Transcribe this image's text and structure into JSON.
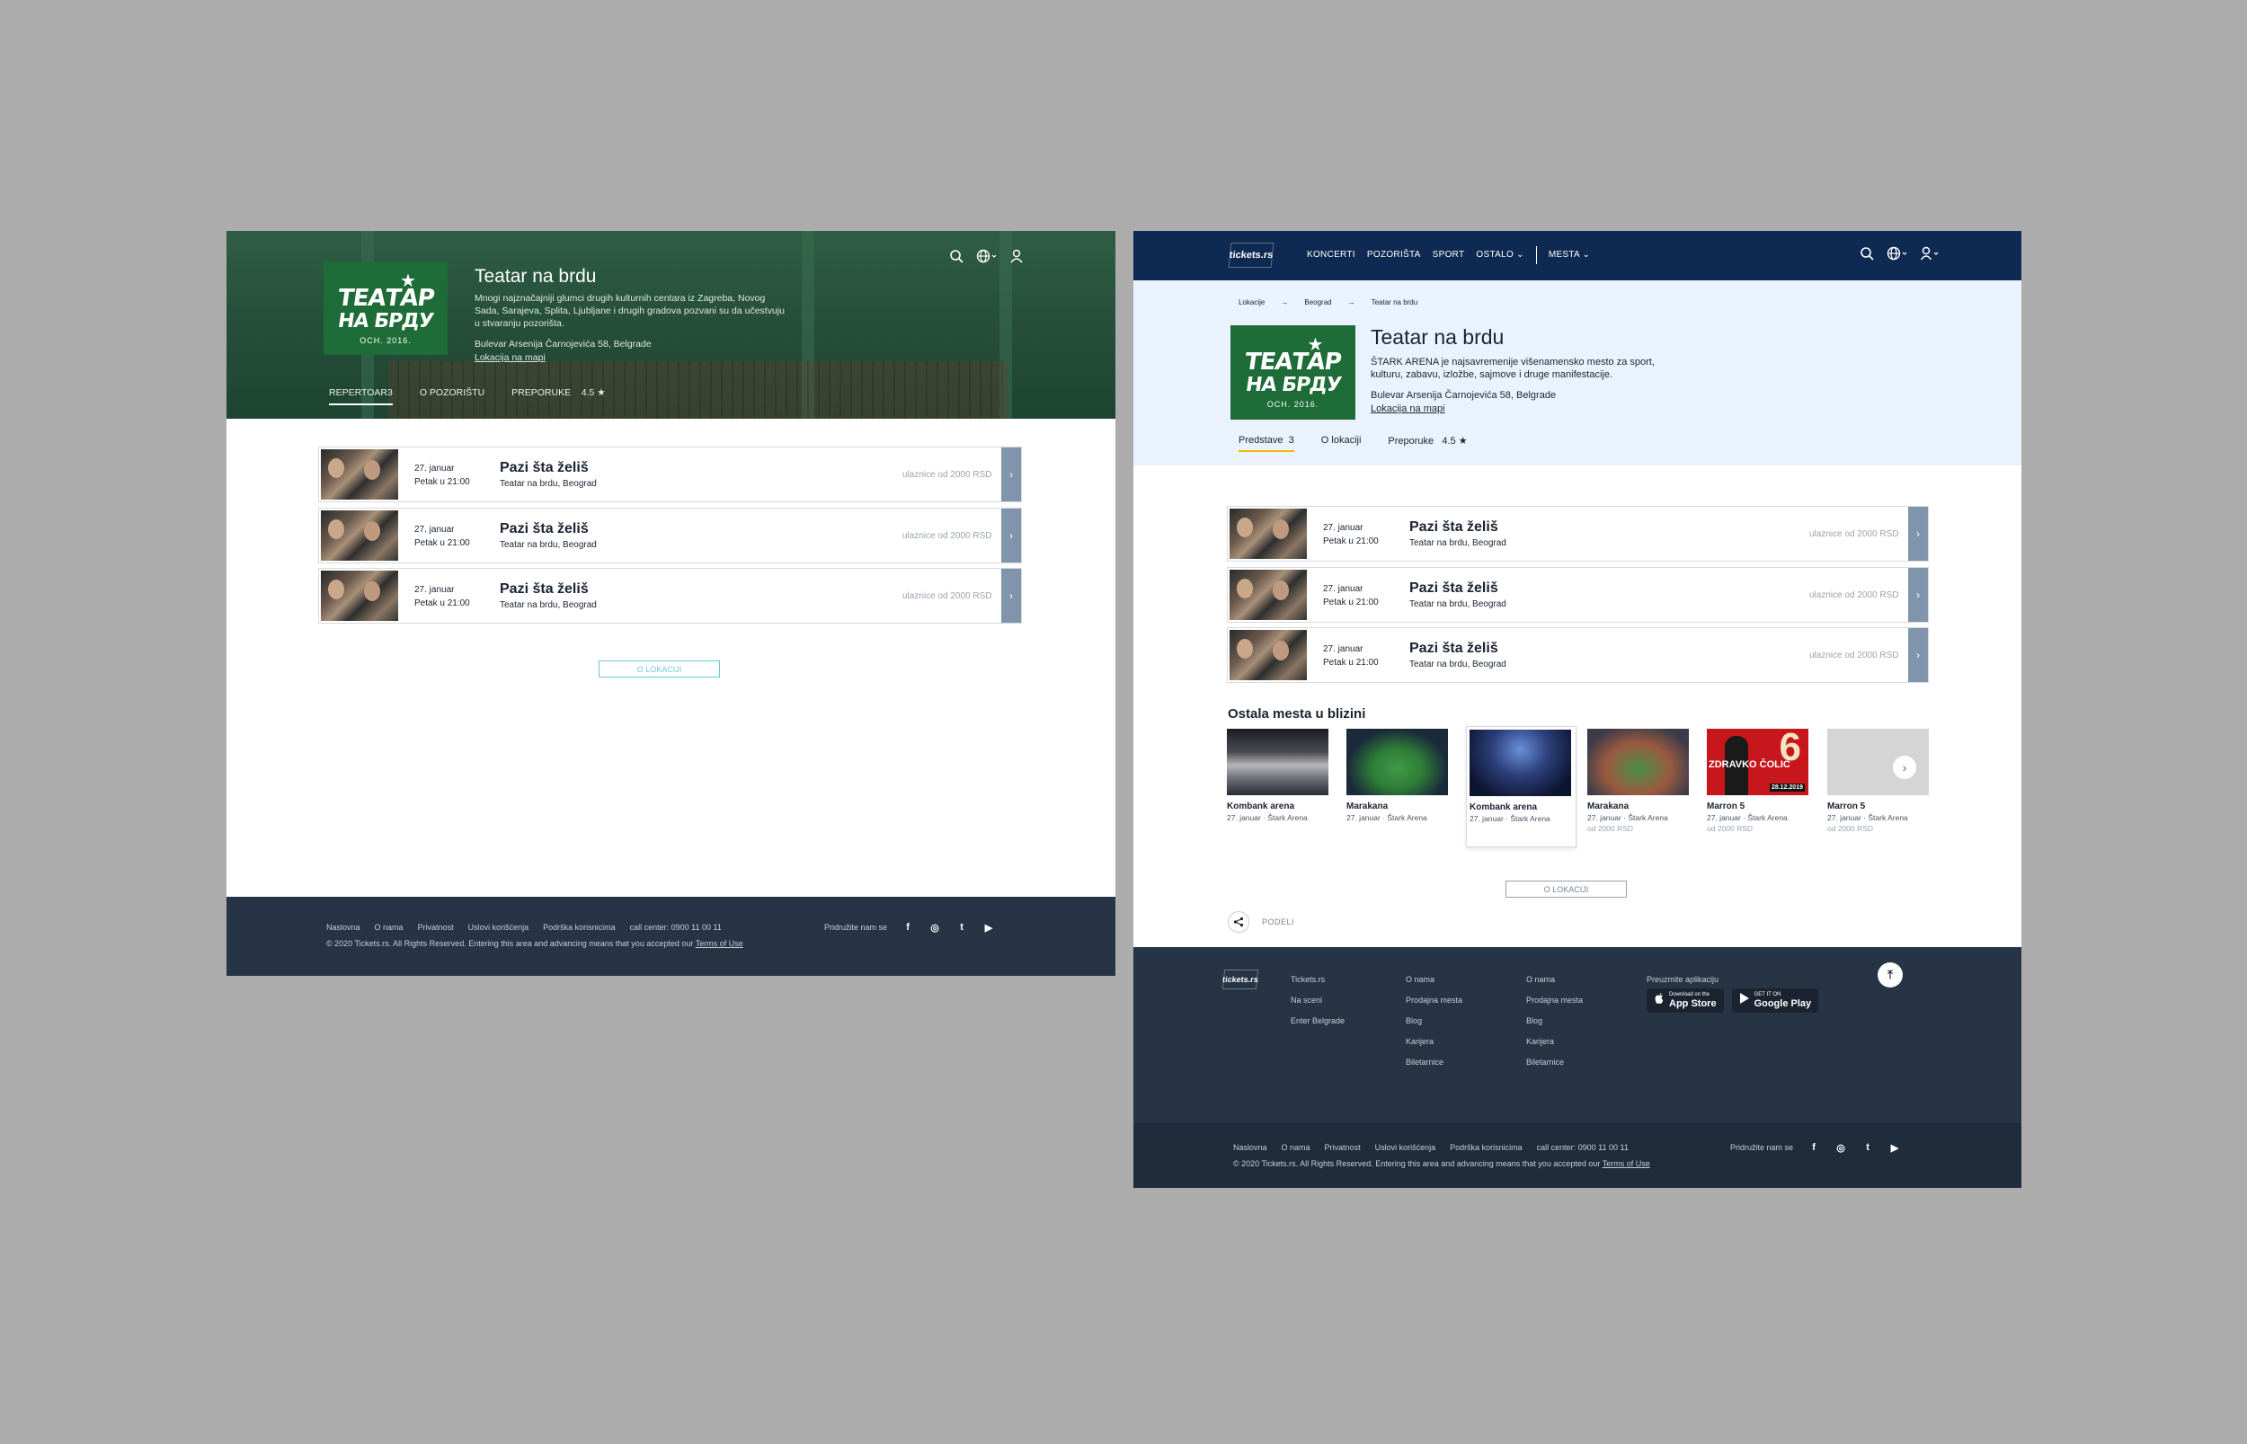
{
  "left": {
    "hero": {
      "title": "Teatar na brdu",
      "description": "Mnogi najznačajniji glumci drugih kulturnih centara iz Zagreba, Novog Sada, Sarajeva, Splita, Ljubljane i drugih gradova pozvani su da učestvuju u stvaranju pozorišta.",
      "address": "Bulevar Arsenija Čarnojevića 58, Belgrade",
      "map_link": "Lokacija  na mapi"
    },
    "tabs": {
      "repertoar": "REPERTOAR3",
      "o_pozoristu": "O POZORIŠTU",
      "preporuke": "PREPORUKE",
      "rating": "4.5",
      "star": "★"
    },
    "location_button": "O LOKACIJI"
  },
  "logo": {
    "line1": "ТЕАТАР",
    "line2": "НА БРДУ",
    "sub": "OCH. 2016.",
    "star": "★"
  },
  "events": [
    {
      "date": "27. januar",
      "time": "Petak u 21:00",
      "name": "Pazi šta želiš",
      "venue": "Teatar na brdu, Beograd",
      "price": "ulaznice od 2000 RSD"
    },
    {
      "date": "27. januar",
      "time": "Petak u 21:00",
      "name": "Pazi šta želiš",
      "venue": "Teatar na brdu, Beograd",
      "price": "ulaznice od 2000 RSD"
    },
    {
      "date": "27. januar",
      "time": "Petak u 21:00",
      "name": "Pazi šta želiš",
      "venue": "Teatar na brdu, Beograd",
      "price": "ulaznice od 2000 RSD"
    }
  ],
  "icons": {
    "search": "search-icon",
    "globe": "globe-icon",
    "user": "user-icon",
    "chevron": "›",
    "arrow": "→"
  },
  "right": {
    "nav": {
      "logo": "tickets.rs",
      "menu": [
        "KONCERTI",
        "POZORIŠTA",
        "SPORT",
        "OSTALO ⌄",
        "MESTA ⌄"
      ]
    },
    "breadcrumbs": [
      "Lokacije",
      "Beograd",
      "Teatar na brdu"
    ],
    "hero": {
      "title": "Teatar na brdu",
      "description": "ŠTARK ARENA  je najsavremenije višenamensko mesto za sport, kulturu, zabavu, izložbe, sajmove i druge manifestacije.",
      "address": "Bulevar Arsenija Čarnojevića 58, Belgrade",
      "map_link": "Lokacija  na mapi"
    },
    "tabs": {
      "predstave": "Predstave",
      "predstave_count": "3",
      "o_lokaciji": "O lokaciji",
      "preporuke": "Preporuke",
      "rating": "4.5",
      "star": "★"
    },
    "nearby": {
      "title": "Ostala mesta u blizini",
      "cards": [
        {
          "name": "Kombank arena",
          "date": "27. januar",
          "venue": "Štark Arena",
          "price": ""
        },
        {
          "name": "Marakana",
          "date": "27. januar",
          "venue": "Štark Arena",
          "price": ""
        },
        {
          "name": "Kombank arena",
          "date": "27. januar",
          "venue": "Štark Arena",
          "price": ""
        },
        {
          "name": "Marakana",
          "date": "27. januar",
          "venue": "Štark Arena",
          "price": "od 2000 RSD"
        },
        {
          "name": "Marron 5",
          "date": "27. januar",
          "venue": "Štark Arena",
          "price": "od 2000 RSD",
          "poster_big": "6",
          "poster_name": "ZDRAVKO ČOLIĆ",
          "poster_date": "28.12.2019"
        },
        {
          "name": "Marron 5",
          "date": "27. januar",
          "venue": "Štark Arena",
          "price": "od 2000 RSD"
        }
      ]
    },
    "location_button": "O LOKACIJI",
    "share": "PODELI",
    "footer": {
      "logo": "tickets.rs",
      "col1": [
        "Tickets.rs",
        "Na sceni",
        "Enter Belgrade"
      ],
      "col2": [
        "O nama",
        "Prodajna mesta",
        "Blog",
        "Karijera",
        "Biletarnice"
      ],
      "col3": [
        "O nama",
        "Prodajna mesta",
        "Blog",
        "Karijera",
        "Biletarnice"
      ],
      "apps_title": "Preuzmite aplikaciju",
      "appstore_small": "Download on the",
      "appstore_big": "App Store",
      "googleplay_small": "GET IT ON",
      "googleplay_big": "Google Play",
      "top_icon": "⤒"
    }
  },
  "footer": {
    "links": [
      "Naslovna",
      "O nama",
      "Privatnost",
      "Uslovi korišćenja",
      "Podrška korisnicima",
      "call center: 0900 11 00 11"
    ],
    "copyright": "© 2020  Tickets.rs. All Rights Reserved. Entering this area and advancing means that you accepted our",
    "terms": "Terms of Use",
    "join": "Pridružite nam se",
    "social": [
      "f",
      "◎",
      "t",
      "▶"
    ]
  },
  "colors": {
    "background": "#acacac",
    "hero_green": "#254d39",
    "nav_blue": "#0f2a52",
    "hero_light": "#eaf3fd",
    "footer": "#263445",
    "arrow": "#8094ab",
    "accent_cyan": "#6cc9d8",
    "tab_underline": "#f4b400"
  }
}
